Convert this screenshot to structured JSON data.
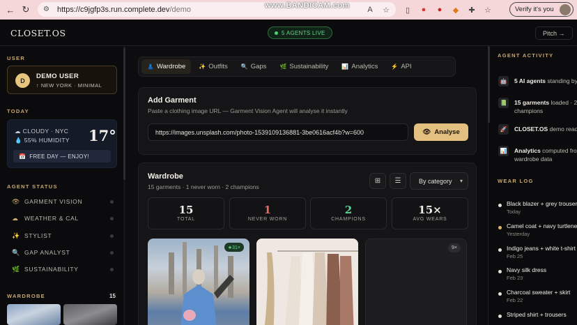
{
  "browser": {
    "url_host": "https://c9jgfp3s.run.complete.dev",
    "url_path": "/demo",
    "watermark": "www.BANDICAM.com",
    "profile_label": "Verify it's you"
  },
  "header": {
    "logo": "CLOSET.OS",
    "agents_live": "5 AGENTS LIVE",
    "pitch": "Pitch →"
  },
  "sidebar": {
    "user_title": "USER",
    "user_initial": "D",
    "user_name": "DEMO USER",
    "user_location": "↑ NEW YORK · MINIMAL",
    "today_title": "TODAY",
    "weather_line1": "☁ CLOUDY · NYC",
    "weather_line2": "💧 55% HUMIDITY",
    "temperature": "17°",
    "free_day": "FREE DAY — ENJOY!",
    "agent_status_title": "AGENT STATUS",
    "agents": [
      {
        "label": "GARMENT VISION",
        "icon": "eye-icon",
        "glyph": "👁"
      },
      {
        "label": "WEATHER & CAL",
        "icon": "weather-icon",
        "glyph": "☁"
      },
      {
        "label": "STYLIST",
        "icon": "sparkle-icon",
        "glyph": "✨"
      },
      {
        "label": "GAP ANALYST",
        "icon": "search-icon",
        "glyph": "🔍"
      },
      {
        "label": "SUSTAINABILITY",
        "icon": "leaf-icon",
        "glyph": "🌿"
      }
    ],
    "wardrobe_title": "WARDROBE",
    "wardrobe_count": "15"
  },
  "tabs": [
    {
      "label": "Wardrobe",
      "glyph": "👗"
    },
    {
      "label": "Outfits",
      "glyph": "✨"
    },
    {
      "label": "Gaps",
      "glyph": "🔍"
    },
    {
      "label": "Sustainability",
      "glyph": "🌿"
    },
    {
      "label": "Analytics",
      "glyph": "📊"
    },
    {
      "label": "API",
      "glyph": "⚡"
    }
  ],
  "add_garment": {
    "title": "Add Garment",
    "subtitle": "Paste a clothing image URL — Garment Vision Agent will analyse it instantly",
    "url_value": "https://images.unsplash.com/photo-1539109136881-3be0616acf4b?w=600",
    "analyse_label": "Analyse"
  },
  "wardrobe": {
    "title": "Wardrobe",
    "subtitle": "15 garments · 1 never worn · 2 champions",
    "sort_label": "By category",
    "stats": [
      {
        "value": "15",
        "label": "TOTAL",
        "color": "#f0ede6"
      },
      {
        "value": "1",
        "label": "NEVER WORN",
        "color": "#e56a5f"
      },
      {
        "value": "2",
        "label": "CHAMPIONS",
        "color": "#5fd49a"
      },
      {
        "value": "15×",
        "label": "AVG WEARS",
        "color": "#f0ede6"
      }
    ],
    "tiles": [
      {
        "badge": "★31×"
      },
      {
        "badge": ""
      },
      {
        "badge": "9×"
      }
    ]
  },
  "right": {
    "activity_title": "AGENT ACTIVITY",
    "activity": [
      {
        "bold": "5 AI agents",
        "rest": " standing by",
        "line2": "",
        "glyph": "🤖"
      },
      {
        "bold": "15 garments",
        "rest": " loaded · 2",
        "line2": "champions",
        "glyph": "📗"
      },
      {
        "bold": "CLOSET.OS",
        "rest": " demo ready",
        "line2": "",
        "glyph": "🚀"
      },
      {
        "bold": "Analytics",
        "rest": " computed from",
        "line2": "wardrobe data",
        "glyph": "📊"
      }
    ],
    "log_title": "WEAR LOG",
    "log": [
      {
        "item": "Black blazer + grey trousers",
        "date": "Today"
      },
      {
        "item": "Camel coat + navy turtleneck",
        "date": "Yesterday"
      },
      {
        "item": "Indigo jeans + white t-shirt",
        "date": "Feb 25"
      },
      {
        "item": "Navy silk dress",
        "date": "Feb 23"
      },
      {
        "item": "Charcoal sweater + skirt",
        "date": "Feb 22"
      },
      {
        "item": "Striped shirt + trousers",
        "date": ""
      }
    ]
  },
  "colors": {
    "accent_gold": "#e3c07f",
    "live_green": "#4ed07c",
    "never_worn_red": "#e56a5f",
    "champion_green": "#5fd49a"
  }
}
